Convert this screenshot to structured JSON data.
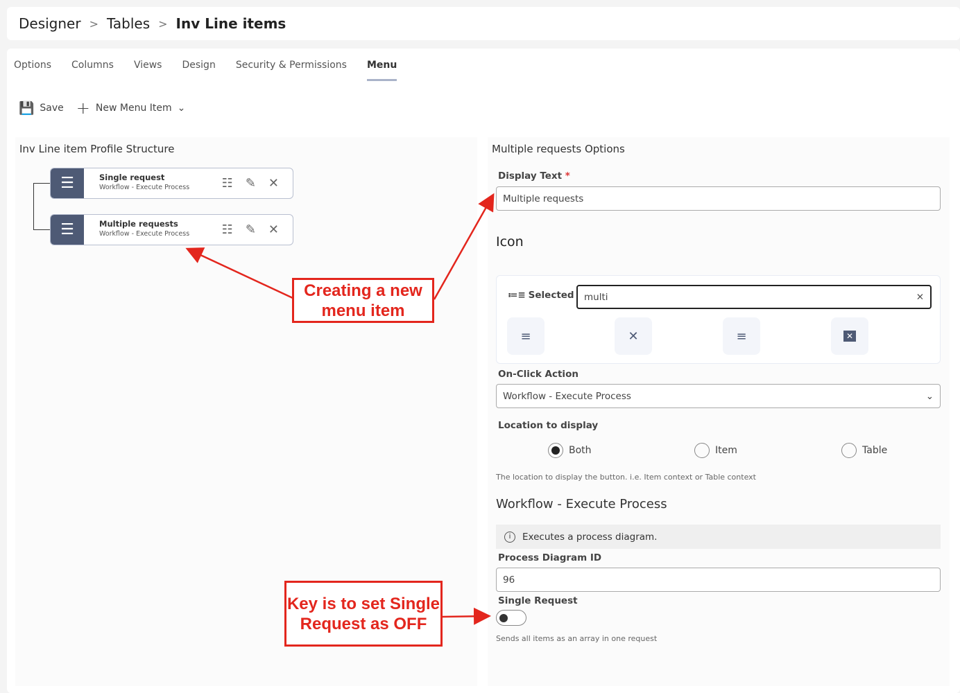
{
  "breadcrumb": [
    "Designer",
    "Tables",
    "Inv Line items"
  ],
  "tabs": [
    {
      "label": "Options"
    },
    {
      "label": "Columns"
    },
    {
      "label": "Views"
    },
    {
      "label": "Design"
    },
    {
      "label": "Security & Permissions"
    },
    {
      "label": "Menu",
      "active": true
    }
  ],
  "toolbar": {
    "save": "Save",
    "new_item": "New Menu Item"
  },
  "left": {
    "title": "Inv Line item Profile Structure",
    "items": [
      {
        "title": "Single request",
        "sub": "Workflow - Execute Process"
      },
      {
        "title": "Multiple requests",
        "sub": "Workflow - Execute Process"
      }
    ]
  },
  "right": {
    "title": "Multiple requests Options",
    "display_text_label": "Display Text",
    "required": "*",
    "display_text_value": "Multiple requests",
    "icon_heading": "Icon",
    "selected_label": "Selected",
    "icon_search": "multi",
    "icon_options": [
      "list-check-icon",
      "close-icon",
      "list-check-right-icon",
      "square-close-icon"
    ],
    "onclick_label": "On-Click Action",
    "onclick_value": "Workflow - Execute Process",
    "location_label": "Location to display",
    "location_options": [
      {
        "label": "Both",
        "selected": true
      },
      {
        "label": "Item",
        "selected": false
      },
      {
        "label": "Table",
        "selected": false
      }
    ],
    "location_help": "The location to display the button. i.e. Item context or Table context",
    "workflow_heading": "Workflow - Execute Process",
    "info": "Executes a process diagram.",
    "pdid_label": "Process Diagram ID",
    "pdid_value": "96",
    "single_label": "Single Request",
    "single_on": false,
    "single_help": "Sends all items as an array in one request"
  },
  "annotations": {
    "a1": "Creating a new menu item",
    "a2": "Key is to set Single Request as OFF"
  },
  "colors": {
    "accent": "#4e5a75",
    "annotation": "#e3261d"
  }
}
